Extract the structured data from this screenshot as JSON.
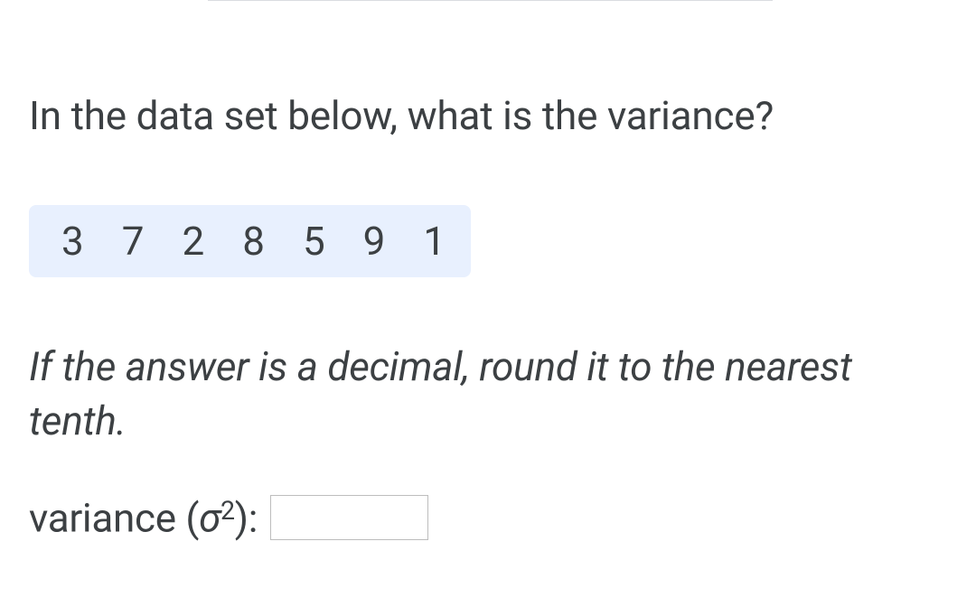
{
  "question": "In the data set below, what is the variance?",
  "data_set": [
    "3",
    "7",
    "2",
    "8",
    "5",
    "9",
    "1"
  ],
  "instruction": "If the answer is a decimal, round it to the nearest tenth.",
  "answer": {
    "label_prefix": "variance (",
    "symbol": "σ",
    "exponent": "2",
    "label_suffix": "):",
    "value": ""
  }
}
